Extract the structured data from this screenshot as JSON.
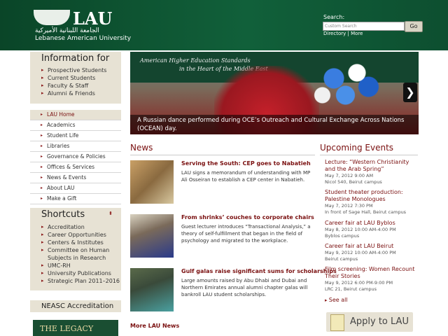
{
  "header": {
    "logo_text": "LAU",
    "logo_arabic": "الجامعة اللبنانية الأميركية",
    "logo_sub": "Lebanese American University",
    "search_label": "Search:",
    "search_placeholder": "Custom Search",
    "go_label": "Go",
    "directory_links": "Directory | More"
  },
  "info_panel": {
    "title": "Information for",
    "items": [
      "Prospective Students",
      "Current Students",
      "Faculty & Staff",
      "Alumni & Friends"
    ]
  },
  "nav": {
    "items": [
      "LAU Home",
      "Academics",
      "Student Life",
      "Libraries",
      "Governance & Policies",
      "Offices & Services",
      "News & Events",
      "About LAU",
      "Make a Gift"
    ]
  },
  "shortcuts": {
    "title": "Shortcuts",
    "items": [
      "Accreditation",
      "Career Opportunities",
      "Centers & Institutes",
      "Committee on Human Subjects in Research",
      "UMC-RH",
      "University Publications",
      "Strategic Plan 2011–2016"
    ]
  },
  "neasc": "NEASC Accreditation",
  "legacy": "THE LEGACY",
  "hero": {
    "banner_line1": "American Higher Education Standards",
    "banner_line2": "in the Heart of the Middle East",
    "caption": "A Russian dance performed during OCE’s Outreach and Cultural Exchange Across Nations (OCEAN) day.",
    "arrow": "❯"
  },
  "news": {
    "heading": "News",
    "items": [
      {
        "title": "Serving the South: CEP goes to Nabatieh",
        "body": "LAU signs a memorandum of understanding with MP Ali Osseiran to establish a CEP center in Nabatieh."
      },
      {
        "title": "From shrinks’ couches to corporate chairs",
        "body": "Guest lecturer introduces “Transactional Analysis,” a theory of self-fulfillment that began in the field of psychology and migrated to the workplace."
      },
      {
        "title": "Gulf galas raise significant sums for scholarships",
        "body": "Large amounts raised by Abu Dhabi and Dubai and Northern Emirates annual alumni chapter galas will bankroll LAU student scholarships."
      }
    ],
    "more": "More LAU News"
  },
  "events": {
    "heading": "Upcoming Events",
    "items": [
      {
        "title": "Lecture: “Western Christianity and the Arab Spring”",
        "date": "May 7, 2012 9:00 AM",
        "place": "Nicol 540, Beirut campus"
      },
      {
        "title": "Student theater production: Palestine Monologues",
        "date": "May 7, 2012 7:30 PM",
        "place": "In front of Sage Hall, Beirut campus"
      },
      {
        "title": "Career fair at LAU Byblos",
        "date": "May 8, 2012 10:00 AM-4:00 PM",
        "place": "Byblos campus"
      },
      {
        "title": "Career fair at LAU Beirut",
        "date": "May 9, 2012 10:00 AM-4:00 PM",
        "place": "Beirut campus"
      },
      {
        "title": "Film screening: Women Recount Their Stories",
        "date": "May 9, 2012 6:00 PM-9:00 PM",
        "place": "LRC 21, Beirut campus"
      }
    ],
    "see_all": "See all",
    "apply": "Apply to LAU"
  }
}
